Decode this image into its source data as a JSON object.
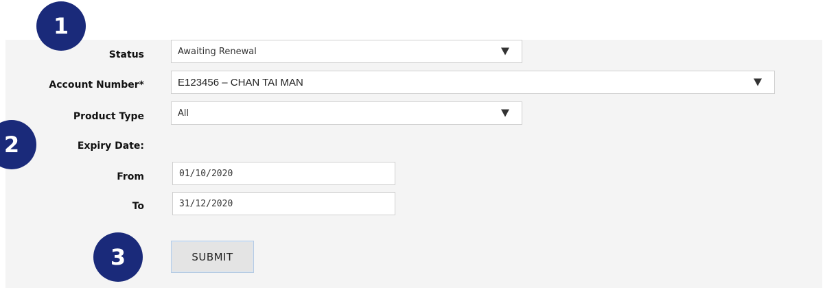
{
  "steps": [
    "1",
    "2",
    "3"
  ],
  "form": {
    "status": {
      "label": "Status",
      "value": "Awaiting Renewal"
    },
    "account": {
      "label": "Account Number*",
      "value": "E123456 – CHAN TAI MAN"
    },
    "product_type": {
      "label": "Product Type",
      "value": "All"
    },
    "expiry": {
      "label": "Expiry Date:",
      "from_label": "From",
      "from_value": "01/10/2020",
      "to_label": "To",
      "to_value": "31/12/2020"
    },
    "submit_label": "SUBMIT"
  },
  "colors": {
    "badge": "#1a2a7a",
    "panel": "#f4f4f4",
    "button_border": "#b6cbe3"
  }
}
